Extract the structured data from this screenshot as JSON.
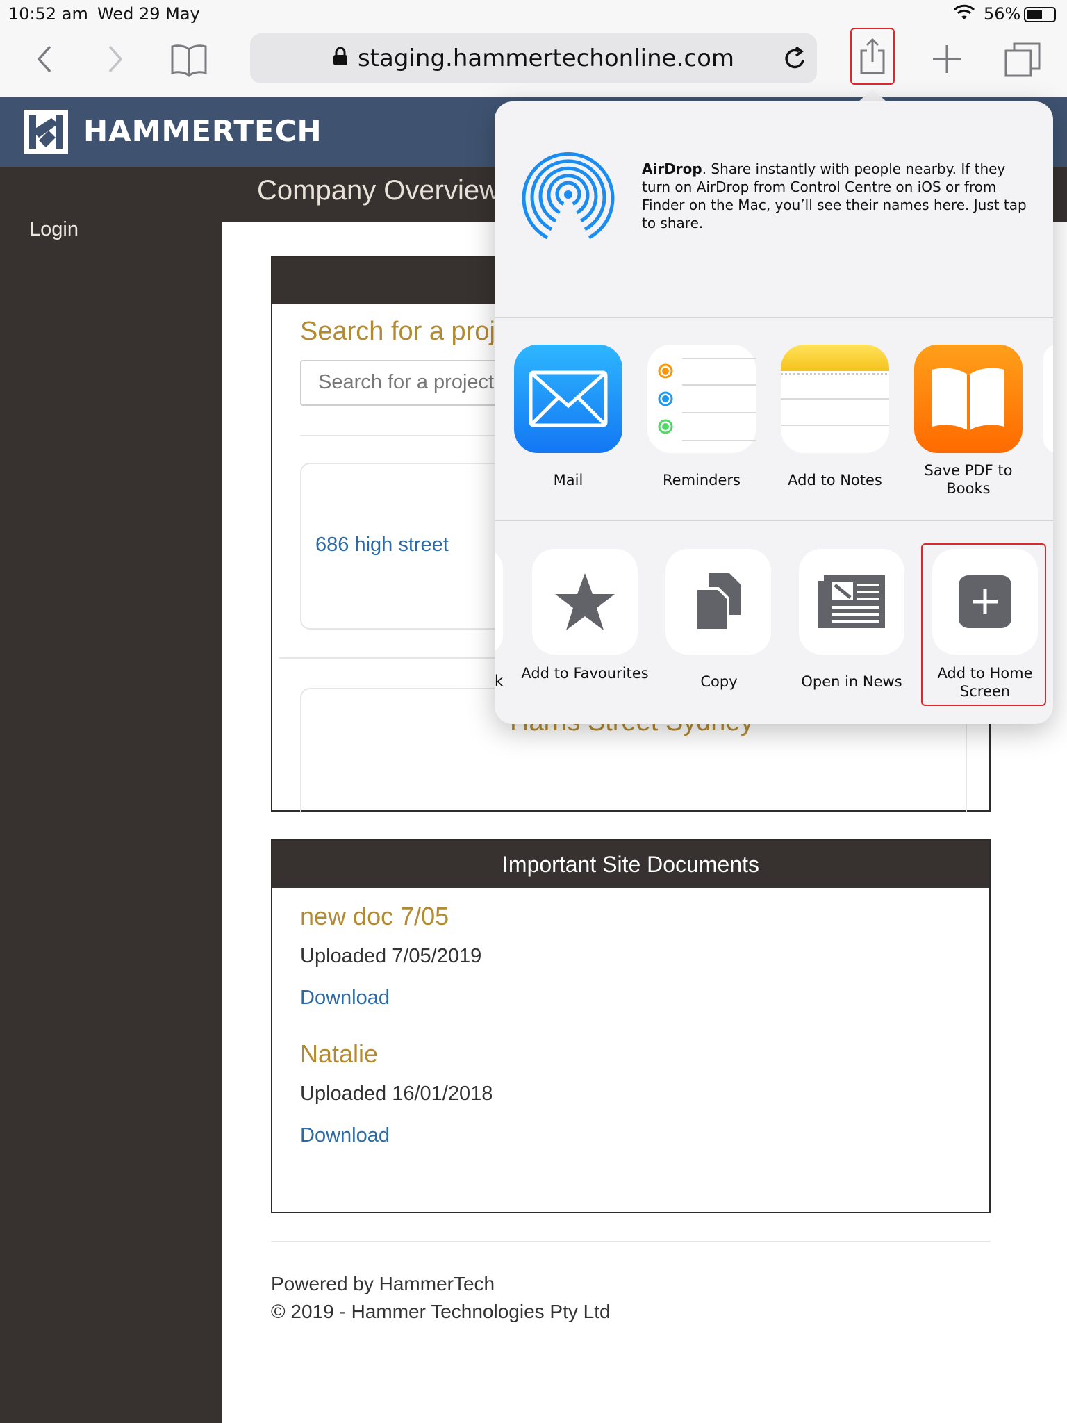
{
  "status_bar": {
    "time": "10:52 am",
    "date": "Wed 29 May",
    "battery": "56%"
  },
  "browser": {
    "url": "staging.hammertechonline.com"
  },
  "site": {
    "logo_text": "HAMMERTECH",
    "page_title": "Company Overview",
    "sidebar_login": "Login",
    "search": {
      "heading": "Search for a project",
      "placeholder": "Search for a project"
    },
    "projects": [
      "686 high street",
      "Harris Street Sydney"
    ],
    "documents": {
      "title": "Important Site Documents",
      "items": [
        {
          "name": "new doc 7/05",
          "uploaded": "Uploaded 7/05/2019",
          "link": "Download"
        },
        {
          "name": "Natalie",
          "uploaded": "Uploaded 16/01/2018",
          "link": "Download"
        }
      ]
    },
    "footer": {
      "powered_by": "Powered by HammerTech",
      "copyright": "© 2019 - Hammer Technologies Pty Ltd"
    }
  },
  "share_sheet": {
    "airdrop_title": "AirDrop",
    "airdrop_text": ". Share instantly with people nearby. If they turn on AirDrop from Control Centre on iOS or from Finder on the Mac, you’ll see their names here. Just tap to share.",
    "apps": [
      {
        "label": "Mail"
      },
      {
        "label": "Reminders"
      },
      {
        "label": "Add to Notes"
      },
      {
        "label": "Save PDF to Books"
      }
    ],
    "partial_action_label": "k",
    "actions": [
      {
        "label": "Add to Favourites"
      },
      {
        "label": "Copy"
      },
      {
        "label": "Open in News"
      },
      {
        "label": "Add to Home Screen"
      }
    ]
  },
  "colors": {
    "header_blue": "#3f5371",
    "sidebar_dark": "#373230",
    "gold": "#b28a32",
    "link_blue": "#2d6aa5",
    "highlight_red": "#e0262a"
  }
}
